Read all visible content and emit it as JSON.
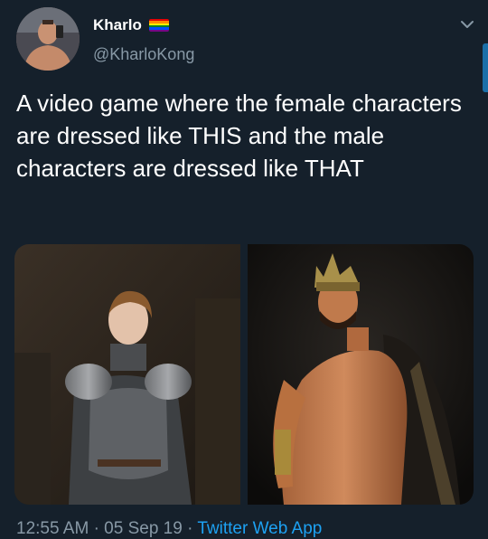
{
  "tweet": {
    "author_name": "Kharlo",
    "author_handle": "@KharloKong",
    "text": "A video game where the female characters are dressed like THIS and the male characters are dressed like THAT",
    "time": "12:55 AM",
    "date": "05 Sep 19",
    "separator": "·",
    "source": "Twitter Web App"
  },
  "icons": {
    "flag": "rainbow-flag-icon",
    "menu": "chevron-down-icon"
  },
  "colors": {
    "background": "#15202b",
    "text": "#ffffff",
    "secondary": "#8899a6",
    "link": "#1da1f2"
  }
}
